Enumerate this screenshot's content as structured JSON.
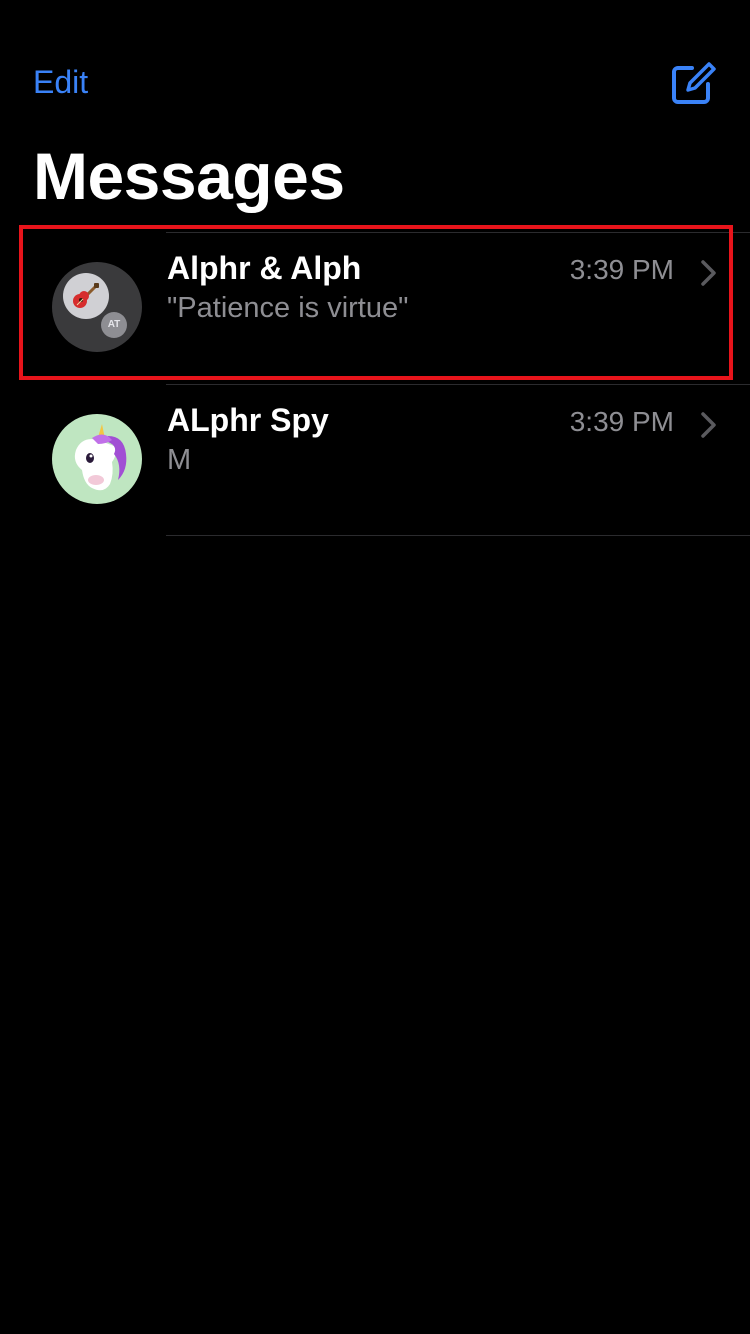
{
  "nav": {
    "edit_label": "Edit",
    "compose_icon": "compose-icon",
    "accent_color": "#3a82f7"
  },
  "page": {
    "title": "Messages"
  },
  "conversations": [
    {
      "name": "Alphr & Alph",
      "preview": "\"Patience is virtue\"",
      "time": "3:39 PM",
      "avatar": {
        "type": "group",
        "icon": "guitar-icon",
        "initials": "AT"
      },
      "highlighted": true
    },
    {
      "name": "ALphr Spy",
      "preview": "M",
      "time": "3:39 PM",
      "avatar": {
        "type": "memoji",
        "icon": "unicorn-icon"
      },
      "highlighted": false
    }
  ],
  "highlight_color": "#e8141b"
}
